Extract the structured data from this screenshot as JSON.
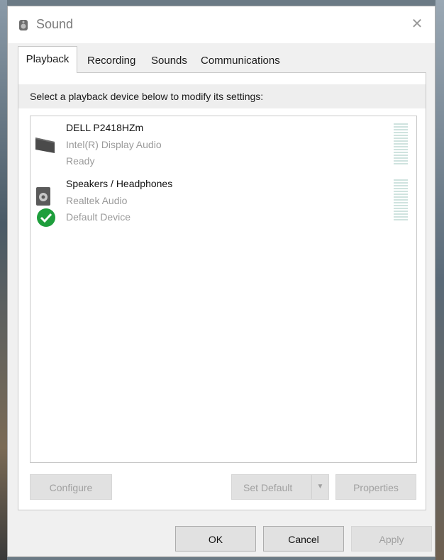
{
  "window": {
    "title": "Sound",
    "close_glyph": "✕"
  },
  "tabs": [
    {
      "label": "Playback",
      "active": true
    },
    {
      "label": "Recording",
      "active": false
    },
    {
      "label": "Sounds",
      "active": false
    },
    {
      "label": "Communications",
      "active": false
    }
  ],
  "playback": {
    "instruction": "Select a playback device below to modify its settings:",
    "devices": [
      {
        "name": "DELL P2418HZm",
        "driver": "Intel(R) Display Audio",
        "status": "Ready",
        "icon": "monitor-icon",
        "is_default": false
      },
      {
        "name": "Speakers / Headphones",
        "driver": "Realtek Audio",
        "status": "Default Device",
        "icon": "speaker-icon",
        "is_default": true,
        "default_badge_icon": "checkmark-icon"
      }
    ],
    "buttons": {
      "configure": "Configure",
      "set_default": "Set Default",
      "set_default_arrow": "▼",
      "properties": "Properties"
    }
  },
  "footer": {
    "ok": "OK",
    "cancel": "Cancel",
    "apply": "Apply"
  },
  "colors": {
    "default_badge": "#1e9e3c",
    "level_meter": "#cfe3df"
  }
}
